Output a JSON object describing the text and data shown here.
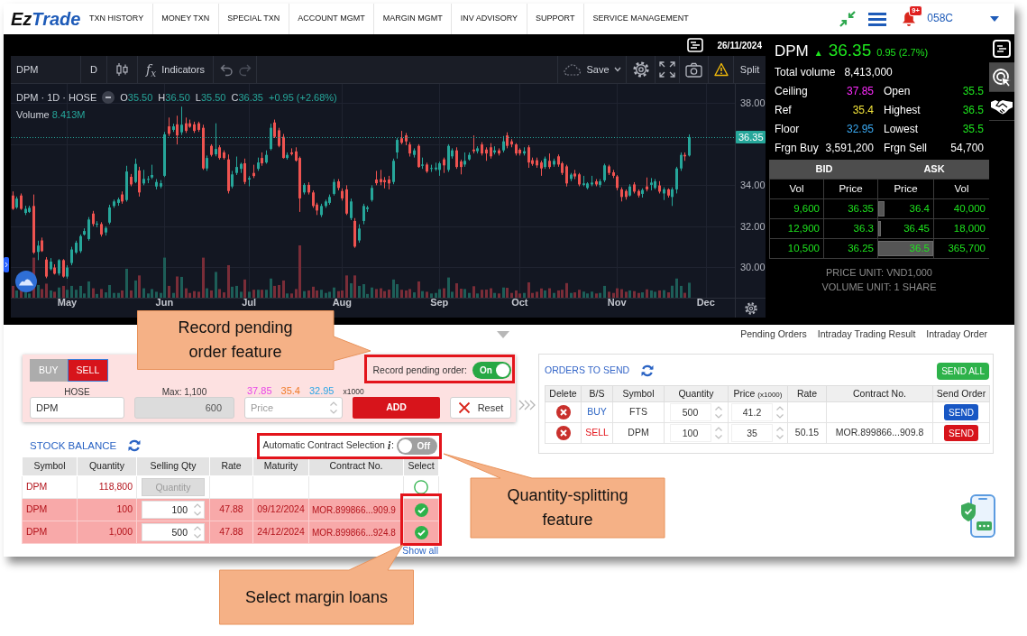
{
  "nav": {
    "logo": [
      "Ez",
      "Trade"
    ],
    "menu": [
      "TXN HISTORY",
      "MONEY TXN",
      "SPECIAL TXN",
      "ACCOUNT MGMT",
      "MARGIN MGMT",
      "INV ADVISORY",
      "SUPPORT",
      "SERVICE MANAGEMENT"
    ],
    "notification_badge": "9+",
    "account": "058C"
  },
  "chart": {
    "date": "26/11/2024",
    "toolbar": {
      "symbol": "DPM",
      "interval": "D",
      "indicators_glyph": "f$_{x}$",
      "indicators": "Indicators",
      "save": "Save",
      "split": "Split"
    },
    "legend": {
      "title": "DPM · 1D · HOSE",
      "ohlc": [
        {
          "label": "O",
          "value": "35.50"
        },
        {
          "label": "H",
          "value": "36.50"
        },
        {
          "label": "L",
          "value": "35.50"
        },
        {
          "label": "C",
          "value": "36.35"
        }
      ],
      "change": "+0.95 (+2.68%)",
      "volume_label": "Volume",
      "volume": "8.413M"
    },
    "chart_data": {
      "type": "candlestick",
      "grid": true,
      "ylim": [
        28.52,
        38.94
      ],
      "yticks": [
        {
          "value": 38,
          "label": "38.00"
        },
        {
          "value": 34,
          "label": "34.00"
        },
        {
          "value": 32,
          "label": "32.00"
        },
        {
          "value": 30,
          "label": "30.00"
        }
      ],
      "ref_lines": [
        {
          "axis": "y",
          "value": 36.35,
          "label": "36.35"
        }
      ],
      "categories": [
        null,
        null,
        null,
        null,
        null,
        null,
        null,
        null,
        null,
        null,
        null,
        null,
        null,
        "May",
        null,
        null,
        null,
        null,
        null,
        null,
        null,
        null,
        null,
        null,
        null,
        null,
        null,
        null,
        null,
        null,
        null,
        null,
        null,
        null,
        null,
        null,
        "Jun",
        null,
        null,
        null,
        null,
        null,
        null,
        null,
        null,
        null,
        null,
        null,
        null,
        null,
        null,
        null,
        null,
        null,
        null,
        null,
        "Jul",
        null,
        null,
        null,
        null,
        null,
        null,
        null,
        null,
        null,
        null,
        null,
        null,
        null,
        null,
        null,
        null,
        null,
        null,
        null,
        null,
        null,
        "Aug",
        null,
        null,
        null,
        null,
        null,
        null,
        null,
        null,
        null,
        null,
        null,
        null,
        null,
        null,
        null,
        null,
        null,
        null,
        null,
        null,
        null,
        null,
        "Sep",
        null,
        null,
        null,
        null,
        null,
        null,
        null,
        null,
        null,
        null,
        null,
        null,
        null,
        null,
        null,
        null,
        null,
        null,
        "Oct",
        null,
        null,
        null,
        null,
        null,
        null,
        null,
        null,
        null,
        null,
        null,
        null,
        null,
        null,
        null,
        null,
        null,
        null,
        null,
        null,
        null,
        null,
        "Nov",
        null,
        null,
        null,
        null,
        null,
        null,
        null,
        null,
        null,
        null,
        null,
        null,
        null,
        null,
        null,
        null,
        null,
        null,
        null,
        null,
        "Dec"
      ],
      "ohlc": [
        [
          33.5,
          33.7,
          32.8,
          32.85
        ],
        [
          32.92,
          33.45,
          32.85,
          33.35
        ],
        [
          33.5,
          33.6,
          32.8,
          32.85
        ],
        [
          32.65,
          33.0,
          32.55,
          32.85
        ],
        [
          32.7,
          33.0,
          32.65,
          32.9
        ],
        [
          32.99,
          33.55,
          30.65,
          30.72
        ],
        [
          30.75,
          31.3,
          30.35,
          31.06
        ],
        [
          31.31,
          31.45,
          30.75,
          30.79
        ],
        [
          30.38,
          30.5,
          29.47,
          29.55
        ],
        [
          29.91,
          30.45,
          29.85,
          30.28
        ],
        [
          29.99,
          30.15,
          29.65,
          29.69
        ],
        [
          29.7,
          30.4,
          29.6,
          30.35
        ],
        [
          30.35,
          30.4,
          29.5,
          29.55
        ],
        [
          29.55,
          30.1,
          29.45,
          29.99
        ],
        [
          30.21,
          31.0,
          30.1,
          30.87
        ],
        [
          30.72,
          31.3,
          30.65,
          31.2
        ],
        [
          30.79,
          31.6,
          30.7,
          31.52
        ],
        [
          31.6,
          31.9,
          31.55,
          31.77
        ],
        [
          31.38,
          32.45,
          31.3,
          32.33
        ],
        [
          32.62,
          32.75,
          32.0,
          32.11
        ],
        [
          32.1,
          32.25,
          31.95,
          32.13
        ],
        [
          32.11,
          32.2,
          31.5,
          31.6
        ],
        [
          31.7,
          32.0,
          31.55,
          31.92
        ],
        [
          32.18,
          33.05,
          32.1,
          32.92
        ],
        [
          32.99,
          33.3,
          32.9,
          33.21
        ],
        [
          33.14,
          33.4,
          33.0,
          33.31
        ],
        [
          33.55,
          33.7,
          33.1,
          33.21
        ],
        [
          33.28,
          34.95,
          33.2,
          34.67
        ],
        [
          34.41,
          34.55,
          33.95,
          34.04
        ],
        [
          34.16,
          35.3,
          34.1,
          35.04
        ],
        [
          34.72,
          34.9,
          33.45,
          33.65
        ],
        [
          34.09,
          34.75,
          34.0,
          34.31
        ],
        [
          34.28,
          34.45,
          34.1,
          34.31
        ],
        [
          34.38,
          35.0,
          34.3,
          34.5
        ],
        [
          33.94,
          34.3,
          33.8,
          34.16
        ],
        [
          33.94,
          34.25,
          33.85,
          34.1
        ],
        [
          34.46,
          36.6,
          34.4,
          36.48
        ],
        [
          36.87,
          37.3,
          36.4,
          36.51
        ],
        [
          36.7,
          37.0,
          36.6,
          36.87
        ],
        [
          36.97,
          37.39,
          35.99,
          36.43
        ],
        [
          36.58,
          37.83,
          36.45,
          36.95
        ],
        [
          37.02,
          37.3,
          36.55,
          36.65
        ],
        [
          37.02,
          37.2,
          36.8,
          36.85
        ],
        [
          36.97,
          37.1,
          36.55,
          36.65
        ],
        [
          37.02,
          37.1,
          36.6,
          36.7
        ],
        [
          36.8,
          36.95,
          34.75,
          34.82
        ],
        [
          34.82,
          35.45,
          34.7,
          35.33
        ],
        [
          35.92,
          36.0,
          35.4,
          35.48
        ],
        [
          35.51,
          37.02,
          35.41,
          35.77
        ],
        [
          35.85,
          35.95,
          35.25,
          35.33
        ],
        [
          35.6,
          35.7,
          35.25,
          35.33
        ],
        [
          35.26,
          35.5,
          33.6,
          33.72
        ],
        [
          33.94,
          34.7,
          33.85,
          34.53
        ],
        [
          34.6,
          35.4,
          34.5,
          34.89
        ],
        [
          34.8,
          35.1,
          34.6,
          35.04
        ],
        [
          35.07,
          35.3,
          34.05,
          34.16
        ],
        [
          34.28,
          34.45,
          33.95,
          34.35
        ],
        [
          34.6,
          35.0,
          34.35,
          34.45
        ],
        [
          34.8,
          35.35,
          34.7,
          35.11
        ],
        [
          35.33,
          35.6,
          34.95,
          35.07
        ],
        [
          35.11,
          35.7,
          35.05,
          35.48
        ],
        [
          35.77,
          37.0,
          35.7,
          36.8
        ],
        [
          37.06,
          37.2,
          36.3,
          36.36
        ],
        [
          36.68,
          36.8,
          35.85,
          35.92
        ],
        [
          36.36,
          36.5,
          35.3,
          35.33
        ],
        [
          35.33,
          35.6,
          35.25,
          35.48
        ],
        [
          35.6,
          35.8,
          35.45,
          35.52
        ],
        [
          35.65,
          35.85,
          35.15,
          35.2
        ],
        [
          35.33,
          35.4,
          32.7,
          33.36
        ],
        [
          33.65,
          34.1,
          33.55,
          34.02
        ],
        [
          34.02,
          34.15,
          33.55,
          33.65
        ],
        [
          33.65,
          33.75,
          32.9,
          32.99
        ],
        [
          33.06,
          33.15,
          32.55,
          32.77
        ],
        [
          32.55,
          33.1,
          32.45,
          32.99
        ],
        [
          32.99,
          33.3,
          32.9,
          33.21
        ],
        [
          33.14,
          33.55,
          33.05,
          33.43
        ],
        [
          33.58,
          34.3,
          33.5,
          34.16
        ],
        [
          34.19,
          34.3,
          33.75,
          33.87
        ],
        [
          33.72,
          33.85,
          33.25,
          33.36
        ],
        [
          33.8,
          34.0,
          32.55,
          32.62
        ],
        [
          32.4,
          33.35,
          32.3,
          33.21
        ],
        [
          32.26,
          32.4,
          30.95,
          31.01
        ],
        [
          31.31,
          32.1,
          31.2,
          31.89
        ],
        [
          32.26,
          33.1,
          32.1,
          32.99
        ],
        [
          32.84,
          33.0,
          32.7,
          32.92
        ],
        [
          33.28,
          34.0,
          33.2,
          33.87
        ],
        [
          34.28,
          34.7,
          34.0,
          34.1
        ],
        [
          34.3,
          34.75,
          34.0,
          34.15
        ],
        [
          34.25,
          34.4,
          33.85,
          34.15
        ],
        [
          34.28,
          34.46,
          33.8,
          34.09
        ],
        [
          34.16,
          35.3,
          34.05,
          35.19
        ],
        [
          35.6,
          36.3,
          35.3,
          36.21
        ],
        [
          36.29,
          36.65,
          36.0,
          36.07
        ],
        [
          36.43,
          36.55,
          35.95,
          36.14
        ],
        [
          35.99,
          36.1,
          35.4,
          35.55
        ],
        [
          35.48,
          35.8,
          35.35,
          35.7
        ],
        [
          35.92,
          36.0,
          34.85,
          34.89
        ],
        [
          34.95,
          35.35,
          34.8,
          35.01
        ],
        [
          35.01,
          35.1,
          34.6,
          34.67
        ],
        [
          34.8,
          35.0,
          34.65,
          34.84
        ],
        [
          34.78,
          35.1,
          34.7,
          34.86
        ],
        [
          34.75,
          35.15,
          34.46,
          35.07
        ],
        [
          35.26,
          35.35,
          34.6,
          34.97
        ],
        [
          34.75,
          36.0,
          34.65,
          35.92
        ],
        [
          35.41,
          35.8,
          35.3,
          35.7
        ],
        [
          35.7,
          35.85,
          34.8,
          34.89
        ],
        [
          35.16,
          35.25,
          34.53,
          34.89
        ],
        [
          35.01,
          35.6,
          34.9,
          35.19
        ],
        [
          35.26,
          35.6,
          35.2,
          35.48
        ],
        [
          35.74,
          36.43,
          35.55,
          35.66
        ],
        [
          35.66,
          35.9,
          35.55,
          35.8
        ],
        [
          35.99,
          36.1,
          35.45,
          35.55
        ],
        [
          35.74,
          35.85,
          35.19,
          35.55
        ],
        [
          35.85,
          36.05,
          35.3,
          35.41
        ],
        [
          35.6,
          35.9,
          35.5,
          35.7
        ],
        [
          35.7,
          35.8,
          35.45,
          35.55
        ],
        [
          35.7,
          36.4,
          35.6,
          36.14
        ],
        [
          36.43,
          36.58,
          35.8,
          35.92
        ],
        [
          36.14,
          36.25,
          35.85,
          35.99
        ],
        [
          35.99,
          36.05,
          35.45,
          35.55
        ],
        [
          35.73,
          35.8,
          35.45,
          35.55
        ],
        [
          35.55,
          35.85,
          35.45,
          35.66
        ],
        [
          35.85,
          35.95,
          34.85,
          35.11
        ],
        [
          35.22,
          35.35,
          34.95,
          35.04
        ],
        [
          35.22,
          35.35,
          34.85,
          34.97
        ],
        [
          35.11,
          35.2,
          34.46,
          34.82
        ],
        [
          34.89,
          35.4,
          34.8,
          35.3
        ],
        [
          35.19,
          35.55,
          34.8,
          34.89
        ],
        [
          35.01,
          35.3,
          34.9,
          35.19
        ],
        [
          35.41,
          35.5,
          34.9,
          35.01
        ],
        [
          35.07,
          35.15,
          34.5,
          34.6
        ],
        [
          34.92,
          35.0,
          33.94,
          34.09
        ],
        [
          34.31,
          34.6,
          34.2,
          34.52
        ],
        [
          34.57,
          34.75,
          34.3,
          34.43
        ],
        [
          34.53,
          34.6,
          33.95,
          34.04
        ],
        [
          34.02,
          34.46,
          33.95,
          34.09
        ],
        [
          33.87,
          34.15,
          33.8,
          34.09
        ],
        [
          34.04,
          34.46,
          33.95,
          34.13
        ],
        [
          34.19,
          34.3,
          33.95,
          34.04
        ],
        [
          34.02,
          34.3,
          33.9,
          34.19
        ],
        [
          34.24,
          35.05,
          34.15,
          34.97
        ],
        [
          34.92,
          35.0,
          34.5,
          34.6
        ],
        [
          34.63,
          34.75,
          34.35,
          34.46
        ],
        [
          34.43,
          34.5,
          33.75,
          33.87
        ],
        [
          33.8,
          33.9,
          33.21,
          33.43
        ],
        [
          33.72,
          33.8,
          33.3,
          33.43
        ],
        [
          33.5,
          34.05,
          33.45,
          33.94
        ],
        [
          34.04,
          34.15,
          33.6,
          33.69
        ],
        [
          33.72,
          33.8,
          33.4,
          33.5
        ],
        [
          33.58,
          33.85,
          33.4,
          33.77
        ],
        [
          33.94,
          34.38,
          33.7,
          33.8
        ],
        [
          34.02,
          34.35,
          33.75,
          34.13
        ],
        [
          33.87,
          34.3,
          33.8,
          34.19
        ],
        [
          33.99,
          34.2,
          33.6,
          33.69
        ],
        [
          33.6,
          33.9,
          33.28,
          33.8
        ],
        [
          33.8,
          33.85,
          33.4,
          33.5
        ],
        [
          33.43,
          33.9,
          32.99,
          33.8
        ],
        [
          33.8,
          34.9,
          33.6,
          34.82
        ],
        [
          34.82,
          35.6,
          34.7,
          35.48
        ],
        [
          35.48,
          35.6,
          35.19,
          35.41
        ],
        [
          35.45,
          36.48,
          35.4,
          36.35
        ],
        null,
        null,
        null,
        null
      ]
    }
  },
  "quote": {
    "symbol": "DPM",
    "arrow": "▲",
    "price": "36.35",
    "change": "0.95 (2.7%)",
    "total_volume_label": "Total volume",
    "total_volume": "8,413,000",
    "stats": [
      {
        "label": "Ceiling",
        "value": "37.85",
        "color": "#ff2bff"
      },
      {
        "label": "Open",
        "value": "35.5",
        "color": "#1ee51e"
      },
      {
        "label": "Ref",
        "value": "35.4",
        "color": "#f2e33a"
      },
      {
        "label": "Highest",
        "value": "36.5",
        "color": "#1ee51e"
      },
      {
        "label": "Floor",
        "value": "32.95",
        "color": "#3aa8f0"
      },
      {
        "label": "Lowest",
        "value": "35.5",
        "color": "#1ee51e"
      },
      {
        "label": "Frgn Buy",
        "value": "3,591,200",
        "color": "#ffffff"
      },
      {
        "label": "Frgn Sell",
        "value": "54,700",
        "color": "#ffffff"
      }
    ],
    "order_book": {
      "sides": [
        "BID",
        "ASK"
      ],
      "columns": [
        "Vol",
        "Price",
        "Price",
        "Vol"
      ],
      "rows": [
        {
          "bid": {
            "vol": "9,600",
            "price": "36.35"
          },
          "ask": {
            "price": "36.4",
            "vol": "40,000",
            "level": 0.11
          }
        },
        {
          "bid": {
            "vol": "12,900",
            "price": "36.3"
          },
          "ask": {
            "price": "36.45",
            "vol": "18,000",
            "level": 0.05
          }
        },
        {
          "bid": {
            "vol": "10,500",
            "price": "36.25"
          },
          "ask": {
            "price": "36.5",
            "vol": "365,700",
            "level": 1
          }
        }
      ]
    },
    "units": [
      "PRICE UNIT: VND1,000",
      "VOLUME UNIT: 1 SHARE"
    ]
  },
  "side_tools": [
    {
      "selected": false
    },
    {
      "selected": true
    },
    {
      "selected": false
    }
  ],
  "lower_tabs": [
    {
      "label": "Pending Orders",
      "selected": false
    },
    {
      "label": "Intraday Trading Result",
      "selected": false
    },
    {
      "label": "Intraday Order",
      "selected": false
    }
  ],
  "order_form": {
    "sides": [
      {
        "kind": "buy",
        "label": "BUY",
        "selected": false
      },
      {
        "kind": "sell",
        "label": "SELL",
        "selected": true
      }
    ],
    "record_pending": {
      "label": "Record pending order:",
      "on": true,
      "state": "On"
    },
    "exchange": "HOSE",
    "max": "Max: 1,100",
    "price_hints": [
      {
        "value": "37.85",
        "color": "#e845e8"
      },
      {
        "value": "35.4",
        "color": "#f07c28"
      },
      {
        "value": "32.95",
        "color": "#2aa6e6"
      }
    ],
    "price_unit": "x1000",
    "symbol": "DPM",
    "quantity": {
      "value": "600",
      "disabled": true
    },
    "price_placeholder": "Price",
    "add": "ADD",
    "reset": "Reset"
  },
  "orders_to_send": {
    "title": "ORDERS TO SEND",
    "send_all": "SEND ALL",
    "columns": [
      {
        "label": "Delete"
      },
      {
        "label": "B/S"
      },
      {
        "label": "Symbol"
      },
      {
        "label": "Quantity"
      },
      {
        "label": "Price",
        "unit": "(x1000)"
      },
      {
        "label": "Rate"
      },
      {
        "label": "Contract No."
      },
      {
        "label": "Send Order"
      }
    ],
    "rows": [
      {
        "kind": "buy",
        "side": "BUY",
        "symbol": "FTS",
        "quantity": "500",
        "price": "41.2",
        "send": "SEND"
      },
      {
        "kind": "sell",
        "side": "SELL",
        "symbol": "DPM",
        "quantity": "100",
        "price": "35",
        "rate": "50.15",
        "contract": "MOR.899866...909.8",
        "send": "SEND"
      }
    ]
  },
  "stock_balance": {
    "title": "STOCK BALANCE",
    "auto_contract": {
      "label": "Automatic Contract Selection",
      "info_mark": "i",
      "label_suffix": ":",
      "on": false,
      "state": "Off"
    },
    "columns": [
      "Symbol",
      "Quantity",
      "Selling Qty",
      "Rate",
      "Maturity",
      "Contract No.",
      "Select"
    ],
    "rows": [
      {
        "symbol": "DPM",
        "quantity": "118,800",
        "selling_qty": {
          "placeholder": "Quantity",
          "disabled": true
        },
        "selected": false
      },
      {
        "symbol": "DPM",
        "quantity": "100",
        "selling_qty": {
          "value": "100",
          "disabled": false
        },
        "rate": "47.88",
        "maturity": "09/12/2024",
        "contract": "MOR.899866...909.9",
        "selected": true
      },
      {
        "symbol": "DPM",
        "quantity": "1,000",
        "selling_qty": {
          "value": "500",
          "disabled": false
        },
        "rate": "47.88",
        "maturity": "24/12/2024",
        "contract": "MOR.899866...924.8",
        "selected": true
      }
    ],
    "show_all": "Show all"
  },
  "annotations": [
    {
      "text": "Record pending order feature"
    },
    {
      "text": "Quantity-splitting feature"
    },
    {
      "text": "Select margin loans"
    }
  ]
}
